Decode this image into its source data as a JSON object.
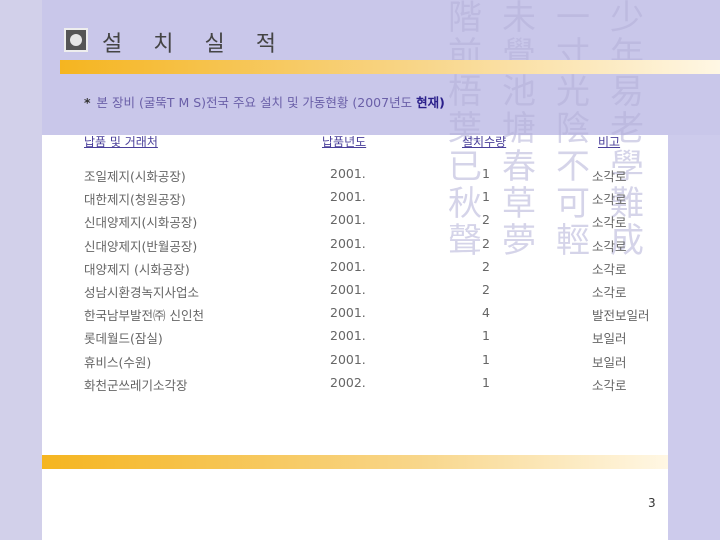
{
  "slide": {
    "title": "설 치 실 적",
    "note": {
      "star": "*",
      "text": "본 장비 (굴뚝T M S)전국 주요 설치 및 가동현황 (2007년도 ",
      "highlight": "현재)"
    },
    "table": {
      "headers": [
        "납품 및 거래처",
        "납품년도",
        "설치수량",
        "비고"
      ],
      "rows": [
        {
          "name": "조일제지(시화공장)",
          "year": "2001.",
          "qty": "1",
          "note": "소각로"
        },
        {
          "name": "대한제지(청원공장)",
          "year": "2001.",
          "qty": "1",
          "note": "소각로"
        },
        {
          "name": "신대양제지(시화공장)",
          "year": "2001.",
          "qty": "2",
          "note": "소각로"
        },
        {
          "name": "신대양제지(반월공장)",
          "year": "2001.",
          "qty": "2",
          "note": "소각로"
        },
        {
          "name": "대양제지 (시화공장)",
          "year": "2001.",
          "qty": "2",
          "note": "소각로"
        },
        {
          "name": "성남시환경녹지사업소",
          "year": "2001.",
          "qty": "2",
          "note": "소각로"
        },
        {
          "name": "한국남부발전㈜ 신인천",
          "year": "2001.",
          "qty": "4",
          "note": "발전보일러"
        },
        {
          "name": "롯데월드(잠실)",
          "year": "2001.",
          "qty": "1",
          "note": "보일러"
        },
        {
          "name": "휴비스(수원)",
          "year": "2001.",
          "qty": "1",
          "note": "보일러"
        },
        {
          "name": "화천군쓰레기소각장",
          "year": "2002.",
          "qty": "1",
          "note": "소각로"
        }
      ]
    },
    "page_number": "3",
    "background_chars": [
      "階",
      "未",
      "一",
      "少",
      "前",
      "覺",
      "寸",
      "年",
      "梧",
      "池",
      "光",
      "易",
      "葉",
      "塘",
      "陰",
      "老",
      "已",
      "春",
      "不",
      "學",
      "秋",
      "草",
      "可",
      "難",
      "聲",
      "夢",
      "輕",
      "成"
    ]
  },
  "colors": {
    "panel": "#c9c7ea",
    "accent": "#f5b520",
    "header_text": "#4a3f9a",
    "body_text": "#666666"
  }
}
